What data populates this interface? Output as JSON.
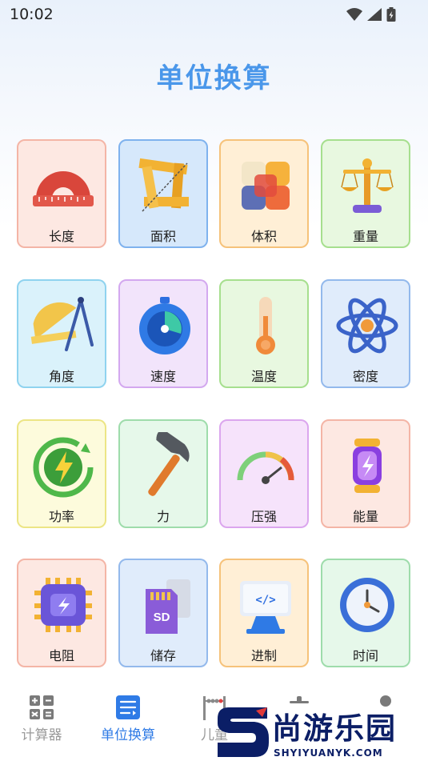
{
  "status": {
    "time": "10:02"
  },
  "header": {
    "title": "单位换算"
  },
  "colors": {
    "accent": "#4a97ea",
    "tab_active": "#2f7be6",
    "tab_inactive": "#9a9a9a"
  },
  "cards": [
    {
      "label": "长度",
      "icon": "ruler-protractor-icon",
      "bg": "#fde8e2",
      "border": "#f4b5a6"
    },
    {
      "label": "面积",
      "icon": "area-rulers-icon",
      "bg": "#d6e8fb",
      "border": "#7fb2ee"
    },
    {
      "label": "体积",
      "icon": "cube-icon",
      "bg": "#ffefd6",
      "border": "#f6c27a"
    },
    {
      "label": "重量",
      "icon": "scale-icon",
      "bg": "#e8f8e0",
      "border": "#a6df8e"
    },
    {
      "label": "角度",
      "icon": "protractor-compass-icon",
      "bg": "#daf2fb",
      "border": "#8fd3ef"
    },
    {
      "label": "速度",
      "icon": "stopwatch-icon",
      "bg": "#f2e4fb",
      "border": "#d3a8ef"
    },
    {
      "label": "温度",
      "icon": "thermometer-icon",
      "bg": "#e8f8e0",
      "border": "#a6df8e"
    },
    {
      "label": "密度",
      "icon": "atom-icon",
      "bg": "#e0ecfb",
      "border": "#93b9ec"
    },
    {
      "label": "功率",
      "icon": "power-bolt-icon",
      "bg": "#fdfbdc",
      "border": "#ece585"
    },
    {
      "label": "力",
      "icon": "hammer-icon",
      "bg": "#e6f8ea",
      "border": "#9edcab"
    },
    {
      "label": "压强",
      "icon": "pressure-gauge-icon",
      "bg": "#f6e3fb",
      "border": "#dba6ee"
    },
    {
      "label": "能量",
      "icon": "energy-lantern-icon",
      "bg": "#fde8e2",
      "border": "#f4b5a6"
    },
    {
      "label": "电阻",
      "icon": "chip-icon",
      "bg": "#fde8e2",
      "border": "#f4b5a6"
    },
    {
      "label": "储存",
      "icon": "sd-card-icon",
      "bg": "#e0ecfb",
      "border": "#93b9ec"
    },
    {
      "label": "进制",
      "icon": "code-monitor-icon",
      "bg": "#ffefd6",
      "border": "#f6c27a"
    },
    {
      "label": "时间",
      "icon": "clock-icon",
      "bg": "#e6f8ea",
      "border": "#9edcab"
    }
  ],
  "tabs": [
    {
      "label": "计算器",
      "icon": "calculator-icon",
      "active": false
    },
    {
      "label": "单位换算",
      "icon": "unit-convert-icon",
      "active": true
    },
    {
      "label": "儿童",
      "icon": "abacus-icon",
      "active": false
    },
    {
      "label": "",
      "icon": "tool-icon",
      "active": false
    },
    {
      "label": "",
      "icon": "profile-icon",
      "active": false
    }
  ],
  "watermark": {
    "text": "尚游乐园",
    "url": "SHYIYUANYK.COM"
  }
}
